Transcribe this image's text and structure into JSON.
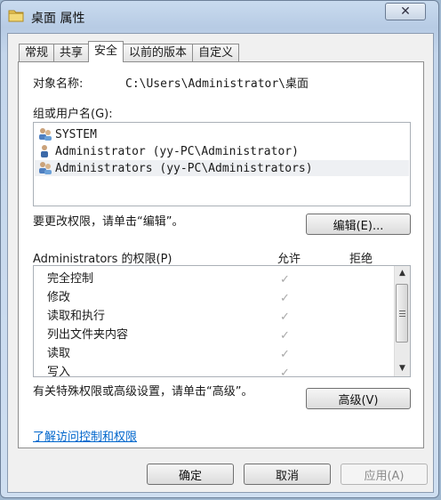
{
  "window": {
    "title": "桌面 属性"
  },
  "tabs": [
    {
      "label": "常规"
    },
    {
      "label": "共享"
    },
    {
      "label": "安全"
    },
    {
      "label": "以前的版本"
    },
    {
      "label": "自定义"
    }
  ],
  "security": {
    "object_label": "对象名称:",
    "object_value": "C:\\Users\\Administrator\\桌面",
    "group_label": "组或用户名(G):",
    "users": [
      {
        "name": "SYSTEM",
        "icon": "user-group-icon"
      },
      {
        "name": "Administrator (yy-PC\\Administrator)",
        "icon": "user-icon"
      },
      {
        "name": "Administrators (yy-PC\\Administrators)",
        "icon": "user-group-icon"
      }
    ],
    "edit_hint": "要更改权限，请单击“编辑”。",
    "edit_button": "编辑(E)...",
    "perm_title": "Administrators 的权限(P)",
    "allow_header": "允许",
    "deny_header": "拒绝",
    "permissions": [
      {
        "name": "完全控制",
        "allow": "✓"
      },
      {
        "name": "修改",
        "allow": "✓"
      },
      {
        "name": "读取和执行",
        "allow": "✓"
      },
      {
        "name": "列出文件夹内容",
        "allow": "✓"
      },
      {
        "name": "读取",
        "allow": "✓"
      },
      {
        "name": "写入",
        "allow": "✓"
      }
    ],
    "advanced_hint": "有关特殊权限或高级设置，请单击“高级”。",
    "advanced_button": "高级(V)",
    "learn_link": "了解访问控制和权限"
  },
  "footer": {
    "ok": "确定",
    "cancel": "取消",
    "apply": "应用(A)"
  },
  "colors": {
    "link": "#0066cc",
    "check": "#a8a8a8"
  }
}
